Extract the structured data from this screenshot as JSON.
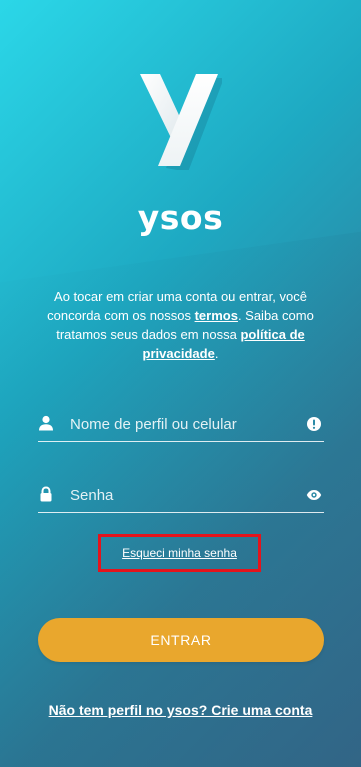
{
  "brand": {
    "name": "ysos",
    "logo_icon": "ysos-y-logo-icon"
  },
  "terms": {
    "text_1": "Ao tocar em criar uma conta ou entrar, você concorda com os nossos ",
    "terms_link": "termos",
    "text_2": ". Saiba como tratamos seus dados em nossa ",
    "privacy_link": "política de privacidade",
    "text_3": "."
  },
  "form": {
    "username": {
      "placeholder": "Nome de perfil ou celular",
      "value": "",
      "left_icon": "person-icon",
      "right_icon": "alert-icon"
    },
    "password": {
      "placeholder": "Senha",
      "value": "",
      "left_icon": "lock-icon",
      "right_icon": "eye-icon"
    },
    "forgot_label": "Esqueci minha senha",
    "submit_label": "ENTRAR"
  },
  "signup": {
    "label": "Não tem perfil no ysos? Crie uma conta"
  },
  "colors": {
    "background_start": "#2bd7e8",
    "background_end": "#3a7092",
    "button": "#e9a72d",
    "highlight_box": "#e4141c",
    "text": "#ffffff"
  }
}
